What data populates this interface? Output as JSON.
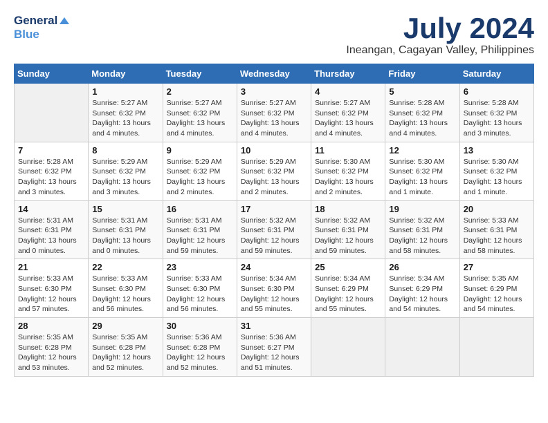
{
  "logo": {
    "line1": "General",
    "line2": "Blue"
  },
  "title": "July 2024",
  "subtitle": "Ineangan, Cagayan Valley, Philippines",
  "days_of_week": [
    "Sunday",
    "Monday",
    "Tuesday",
    "Wednesday",
    "Thursday",
    "Friday",
    "Saturday"
  ],
  "weeks": [
    [
      {
        "day": "",
        "info": ""
      },
      {
        "day": "1",
        "info": "Sunrise: 5:27 AM\nSunset: 6:32 PM\nDaylight: 13 hours\nand 4 minutes."
      },
      {
        "day": "2",
        "info": "Sunrise: 5:27 AM\nSunset: 6:32 PM\nDaylight: 13 hours\nand 4 minutes."
      },
      {
        "day": "3",
        "info": "Sunrise: 5:27 AM\nSunset: 6:32 PM\nDaylight: 13 hours\nand 4 minutes."
      },
      {
        "day": "4",
        "info": "Sunrise: 5:27 AM\nSunset: 6:32 PM\nDaylight: 13 hours\nand 4 minutes."
      },
      {
        "day": "5",
        "info": "Sunrise: 5:28 AM\nSunset: 6:32 PM\nDaylight: 13 hours\nand 4 minutes."
      },
      {
        "day": "6",
        "info": "Sunrise: 5:28 AM\nSunset: 6:32 PM\nDaylight: 13 hours\nand 3 minutes."
      }
    ],
    [
      {
        "day": "7",
        "info": "Sunrise: 5:28 AM\nSunset: 6:32 PM\nDaylight: 13 hours\nand 3 minutes."
      },
      {
        "day": "8",
        "info": "Sunrise: 5:29 AM\nSunset: 6:32 PM\nDaylight: 13 hours\nand 3 minutes."
      },
      {
        "day": "9",
        "info": "Sunrise: 5:29 AM\nSunset: 6:32 PM\nDaylight: 13 hours\nand 2 minutes."
      },
      {
        "day": "10",
        "info": "Sunrise: 5:29 AM\nSunset: 6:32 PM\nDaylight: 13 hours\nand 2 minutes."
      },
      {
        "day": "11",
        "info": "Sunrise: 5:30 AM\nSunset: 6:32 PM\nDaylight: 13 hours\nand 2 minutes."
      },
      {
        "day": "12",
        "info": "Sunrise: 5:30 AM\nSunset: 6:32 PM\nDaylight: 13 hours\nand 1 minute."
      },
      {
        "day": "13",
        "info": "Sunrise: 5:30 AM\nSunset: 6:32 PM\nDaylight: 13 hours\nand 1 minute."
      }
    ],
    [
      {
        "day": "14",
        "info": "Sunrise: 5:31 AM\nSunset: 6:31 PM\nDaylight: 13 hours\nand 0 minutes."
      },
      {
        "day": "15",
        "info": "Sunrise: 5:31 AM\nSunset: 6:31 PM\nDaylight: 13 hours\nand 0 minutes."
      },
      {
        "day": "16",
        "info": "Sunrise: 5:31 AM\nSunset: 6:31 PM\nDaylight: 12 hours\nand 59 minutes."
      },
      {
        "day": "17",
        "info": "Sunrise: 5:32 AM\nSunset: 6:31 PM\nDaylight: 12 hours\nand 59 minutes."
      },
      {
        "day": "18",
        "info": "Sunrise: 5:32 AM\nSunset: 6:31 PM\nDaylight: 12 hours\nand 59 minutes."
      },
      {
        "day": "19",
        "info": "Sunrise: 5:32 AM\nSunset: 6:31 PM\nDaylight: 12 hours\nand 58 minutes."
      },
      {
        "day": "20",
        "info": "Sunrise: 5:33 AM\nSunset: 6:31 PM\nDaylight: 12 hours\nand 58 minutes."
      }
    ],
    [
      {
        "day": "21",
        "info": "Sunrise: 5:33 AM\nSunset: 6:30 PM\nDaylight: 12 hours\nand 57 minutes."
      },
      {
        "day": "22",
        "info": "Sunrise: 5:33 AM\nSunset: 6:30 PM\nDaylight: 12 hours\nand 56 minutes."
      },
      {
        "day": "23",
        "info": "Sunrise: 5:33 AM\nSunset: 6:30 PM\nDaylight: 12 hours\nand 56 minutes."
      },
      {
        "day": "24",
        "info": "Sunrise: 5:34 AM\nSunset: 6:30 PM\nDaylight: 12 hours\nand 55 minutes."
      },
      {
        "day": "25",
        "info": "Sunrise: 5:34 AM\nSunset: 6:29 PM\nDaylight: 12 hours\nand 55 minutes."
      },
      {
        "day": "26",
        "info": "Sunrise: 5:34 AM\nSunset: 6:29 PM\nDaylight: 12 hours\nand 54 minutes."
      },
      {
        "day": "27",
        "info": "Sunrise: 5:35 AM\nSunset: 6:29 PM\nDaylight: 12 hours\nand 54 minutes."
      }
    ],
    [
      {
        "day": "28",
        "info": "Sunrise: 5:35 AM\nSunset: 6:28 PM\nDaylight: 12 hours\nand 53 minutes."
      },
      {
        "day": "29",
        "info": "Sunrise: 5:35 AM\nSunset: 6:28 PM\nDaylight: 12 hours\nand 52 minutes."
      },
      {
        "day": "30",
        "info": "Sunrise: 5:36 AM\nSunset: 6:28 PM\nDaylight: 12 hours\nand 52 minutes."
      },
      {
        "day": "31",
        "info": "Sunrise: 5:36 AM\nSunset: 6:27 PM\nDaylight: 12 hours\nand 51 minutes."
      },
      {
        "day": "",
        "info": ""
      },
      {
        "day": "",
        "info": ""
      },
      {
        "day": "",
        "info": ""
      }
    ]
  ]
}
